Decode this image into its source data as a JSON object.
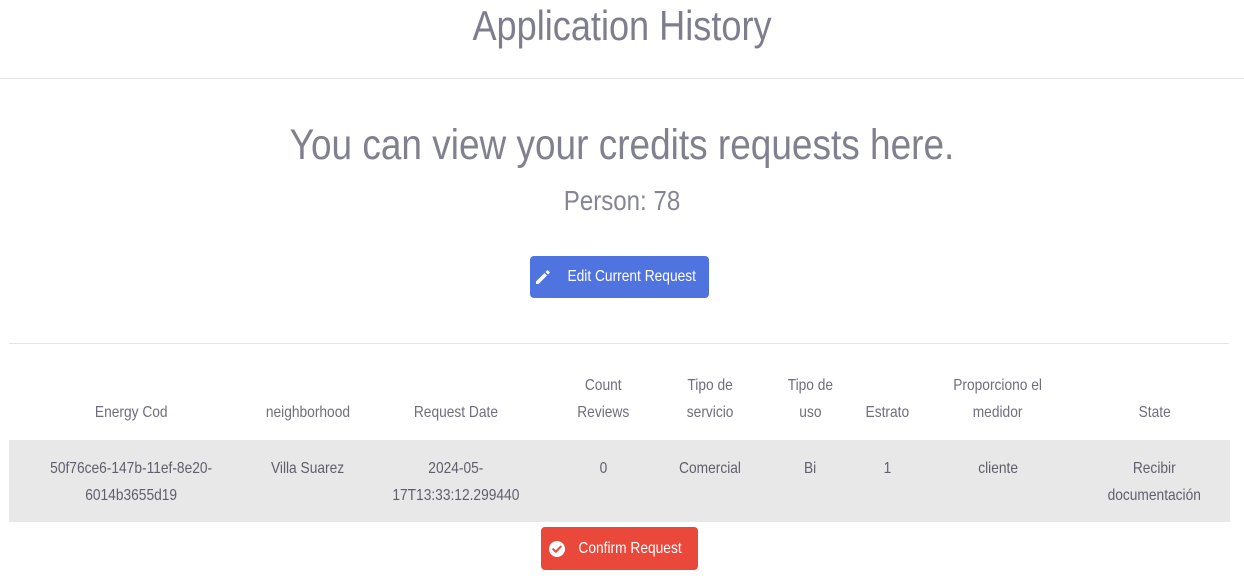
{
  "header": {
    "title": "Application History"
  },
  "intro": {
    "lead": "You can view your credits requests here.",
    "person": "Person: 78"
  },
  "actions": {
    "edit_label": "Edit Current Request",
    "edit_icon": "pencil-icon",
    "confirm_label": "Confirm Request",
    "confirm_icon": "check-circle-icon"
  },
  "colors": {
    "edit_button": "#4f74e0",
    "confirm_button": "#e9483a",
    "row_background": "#e8e8e8"
  },
  "table": {
    "columns": [
      "Energy Cod",
      "neighborhood",
      "Request Date",
      "Count\nReviews",
      "Tipo de\nservicio",
      "Tipo de\nuso",
      "Estrato",
      "Proporciono el\nmedidor",
      "State"
    ],
    "rows": [
      [
        "50f76ce6-147b-11ef-8e20-\n6014b3655d19",
        "Villa Suarez",
        "2024-05-\n17T13:33:12.299440",
        "0",
        "Comercial",
        "Bi",
        "1",
        "cliente",
        "Recibir\ndocumentación"
      ]
    ]
  }
}
